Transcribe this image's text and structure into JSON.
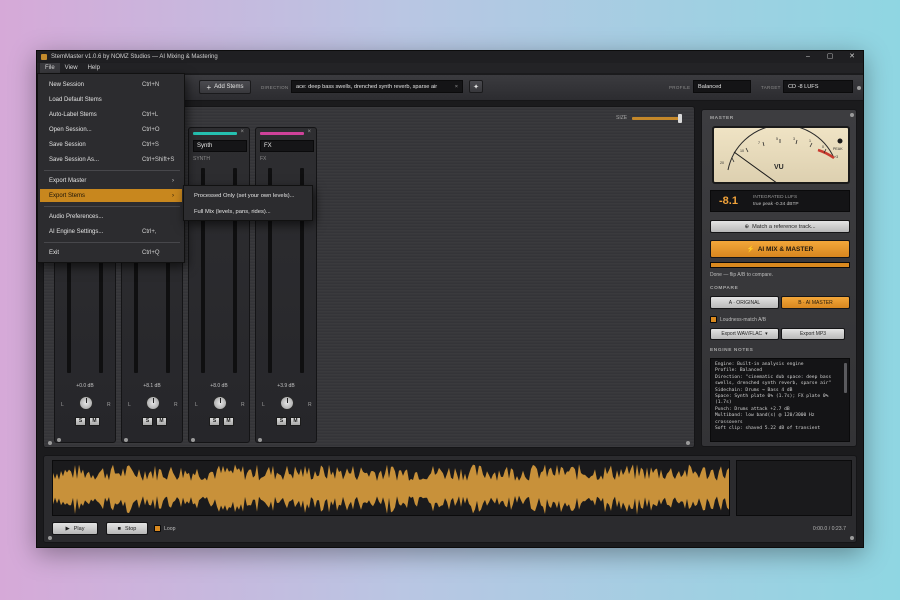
{
  "window": {
    "title": "StemMaster v1.0.6 by NOMZ Studios — AI Mixing & Mastering",
    "controls": [
      "–",
      "▢",
      "✕"
    ]
  },
  "menubar": [
    "File",
    "View",
    "Help"
  ],
  "toolbar": {
    "add_stems": "Add Stems",
    "direction_label": "DIRECTION",
    "direction_value": "ace: deep bass swells, drenched synth reverb, sparse air",
    "clear_symbol": "×",
    "profile_label": "PROFILE",
    "profile_value": "Balanced",
    "target_label": "TARGET",
    "target_value": "CD -8 LUFS"
  },
  "mixer": {
    "size_label": "SIZE",
    "size_level": 0.92,
    "strips": [
      {
        "name": "",
        "role": "",
        "db": "+0.0 dB",
        "solo": "S",
        "mute": "M",
        "color": ""
      },
      {
        "name": "",
        "role": "",
        "db": "+8.1 dB",
        "solo": "S",
        "mute": "M",
        "color": ""
      },
      {
        "name": "Synth",
        "role": "SYNTH",
        "db": "+8.0 dB",
        "solo": "S",
        "mute": "M",
        "color": "#25c0b0"
      },
      {
        "name": "FX",
        "role": "FX",
        "db": "+3.9 dB",
        "solo": "S",
        "mute": "M",
        "color": "#d0429a"
      }
    ],
    "pan_left": "L",
    "pan_right": "R"
  },
  "file_menu": {
    "items": [
      {
        "label": "New Session",
        "shortcut": "Ctrl+N"
      },
      {
        "label": "Load Default Stems",
        "shortcut": ""
      },
      {
        "label": "Auto-Label Stems",
        "shortcut": "Ctrl+L"
      },
      {
        "label": "Open Session...",
        "shortcut": "Ctrl+O"
      },
      {
        "label": "Save Session",
        "shortcut": "Ctrl+S"
      },
      {
        "label": "Save Session As...",
        "shortcut": "Ctrl+Shift+S"
      },
      {
        "label": "Export Master",
        "shortcut": "›"
      },
      {
        "label": "Export Stems",
        "shortcut": "›"
      },
      {
        "label": "Audio Preferences...",
        "shortcut": ""
      },
      {
        "label": "AI Engine Settings...",
        "shortcut": "Ctrl+,"
      },
      {
        "label": "Exit",
        "shortcut": "Ctrl+Q"
      }
    ],
    "submenu": [
      "Processed Only (set your own levels)...",
      "Full Mix (levels, pans, rides)..."
    ]
  },
  "master": {
    "title": "MASTER",
    "vu_label": "VU",
    "peak_label": "PEAK",
    "lufs_value": "-8.1",
    "lufs_label": "INTEGRATED LUFS",
    "true_peak": "true peak -0.34 dBTP",
    "match_button": "Match a reference track...",
    "ai_button": "AI MIX & MASTER",
    "progress": 1.0,
    "status": "Done — flip A/B to compare.",
    "compare_title": "COMPARE",
    "original_button": "A · ORIGINAL",
    "ai_master_button": "B · AI MASTER",
    "loudness_match": "Loudness-match A/B",
    "export_wav": "Export WAV/FLAC",
    "export_mp3": "Export MP3",
    "notes_title": "ENGINE NOTES",
    "notes": [
      "Engine: Built-in analysis engine",
      "Profile: Balanced",
      "Direction: \"cinematic dub space: deep bass swells, drenched synth reverb, sparse air\"",
      "Sidechain: Drums → Bass 4 dB",
      "Space: Synth plate 0% (1.7s); FX plate 0% (1.7s)",
      "Punch: Drums attack +2.7 dB",
      "Multiband: low band(s) @ 120/3000 Hz crossovers",
      "Soft clip: shaved 5.22 dB of transient"
    ]
  },
  "transport": {
    "play": "Play",
    "stop": "Stop",
    "loop": "Loop",
    "time": "0:00.0 / 0:23.7"
  },
  "colors": {
    "accent": "#d9891f",
    "waveform": "#c8913a"
  }
}
